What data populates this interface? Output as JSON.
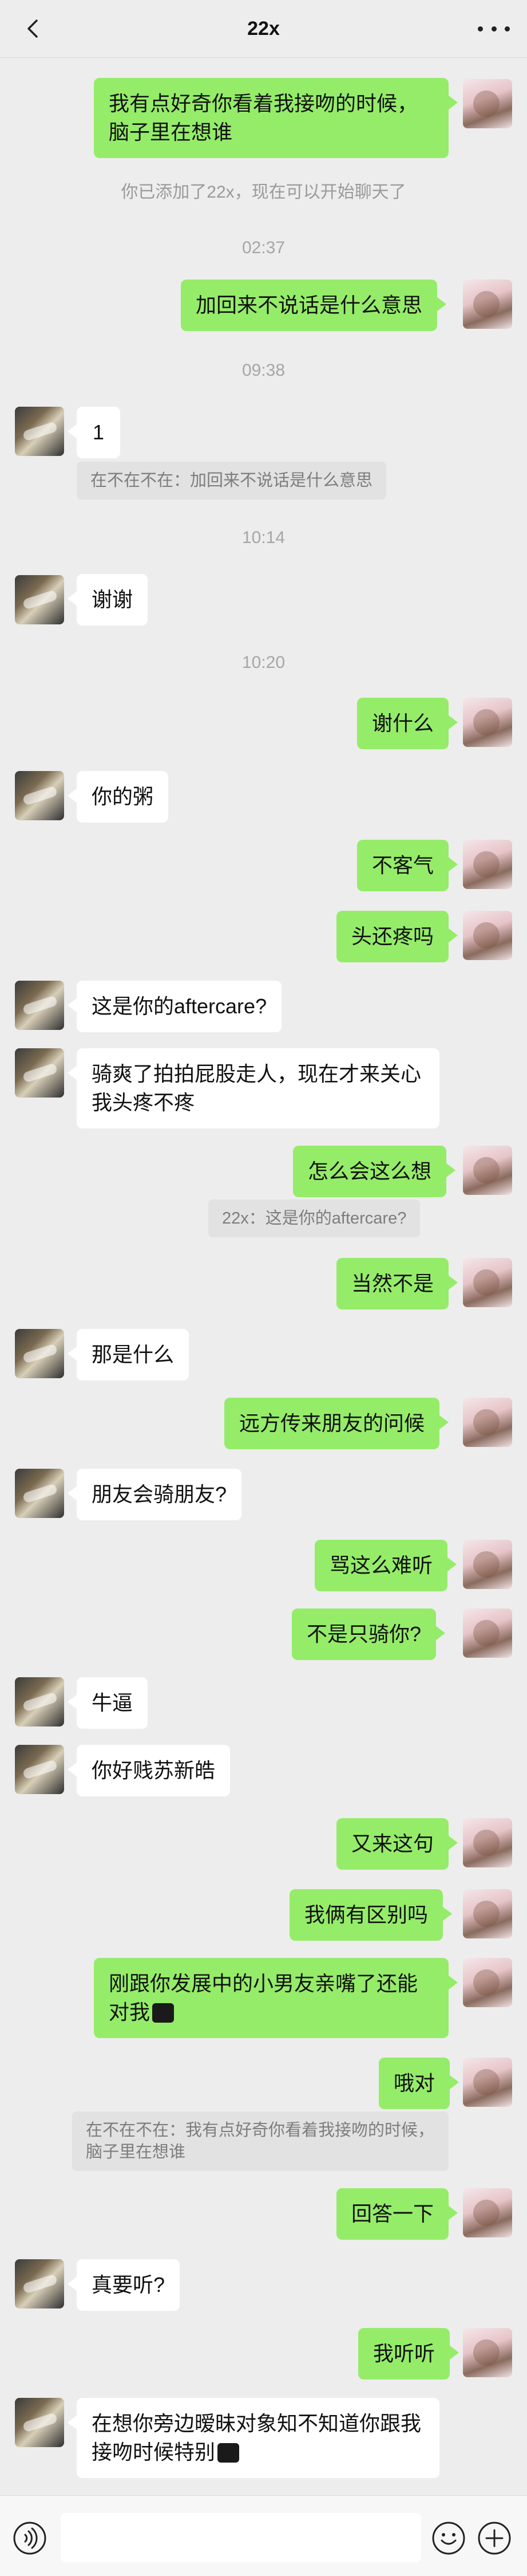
{
  "header": {
    "title": "22x"
  },
  "chat": {
    "m1": "我有点好奇你看着我接吻的时候，脑子里在想谁",
    "sys1": "你已添加了22x，现在可以开始聊天了",
    "t1": "02:37",
    "m2": "加回来不说话是什么意思",
    "t2": "09:38",
    "m3": "1",
    "q1": "在不在不在：加回来不说话是什么意思",
    "t3": "10:14",
    "m4": "谢谢",
    "t4": "10:20",
    "m5": "谢什么",
    "m6": "你的粥",
    "m7": "不客气",
    "m8": "头还疼吗",
    "m9": "这是你的aftercare?",
    "m10": "骑爽了拍拍屁股走人，现在才来关心我头疼不疼",
    "m11": "怎么会这么想",
    "q2": "22x：这是你的aftercare?",
    "m12": "当然不是",
    "m13": "那是什么",
    "m14": "远方传来朋友的问候",
    "m15": "朋友会骑朋友?",
    "m16": "骂这么难听",
    "m17": "不是只骑你?",
    "m18": "牛逼",
    "m19": "你好贱苏新皓",
    "m20": "又来这句",
    "m21": "我俩有区别吗",
    "m22": "刚跟你发展中的小男友亲嘴了还能对我",
    "m23": "哦对",
    "q3": "在不在不在：我有点好奇你看着我接吻的时候，脑子里在想谁",
    "m24": "回答一下",
    "m25": "真要听?",
    "m26": "我听听",
    "m27": "在想你旁边暧昧对象知不知道你跟我接吻时候特别"
  },
  "input": {
    "placeholder": ""
  },
  "colors": {
    "sent": "#95ec69",
    "received": "#ffffff",
    "background": "#ededed"
  }
}
